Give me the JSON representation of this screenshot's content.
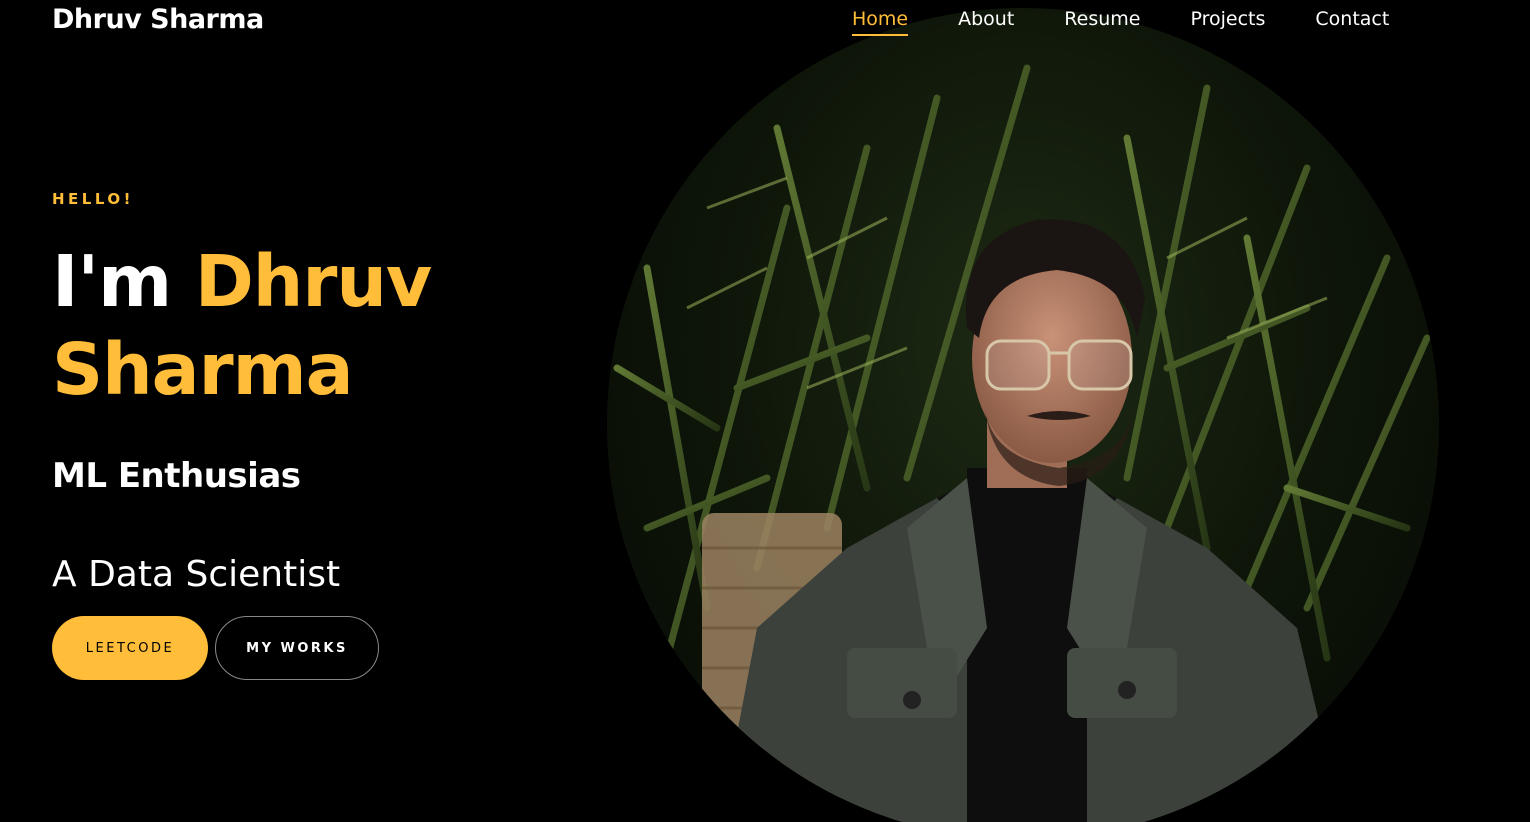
{
  "brand": {
    "name": "Dhruv Sharma"
  },
  "nav": {
    "items": [
      {
        "label": "Home",
        "active": true
      },
      {
        "label": "About",
        "active": false
      },
      {
        "label": "Resume",
        "active": false
      },
      {
        "label": "Projects",
        "active": false
      },
      {
        "label": "Contact",
        "active": false
      }
    ]
  },
  "hero": {
    "greeting": "HELLO!",
    "intro": "I'm",
    "first_name": "Dhruv",
    "last_name": "Sharma",
    "tagline": "ML Enthusias",
    "role": "A Data Scientist",
    "primary_button": "LEETCODE",
    "secondary_button": "MY WORKS"
  },
  "colors": {
    "accent": "#ffbd39",
    "background": "#000000",
    "text": "#ffffff"
  }
}
